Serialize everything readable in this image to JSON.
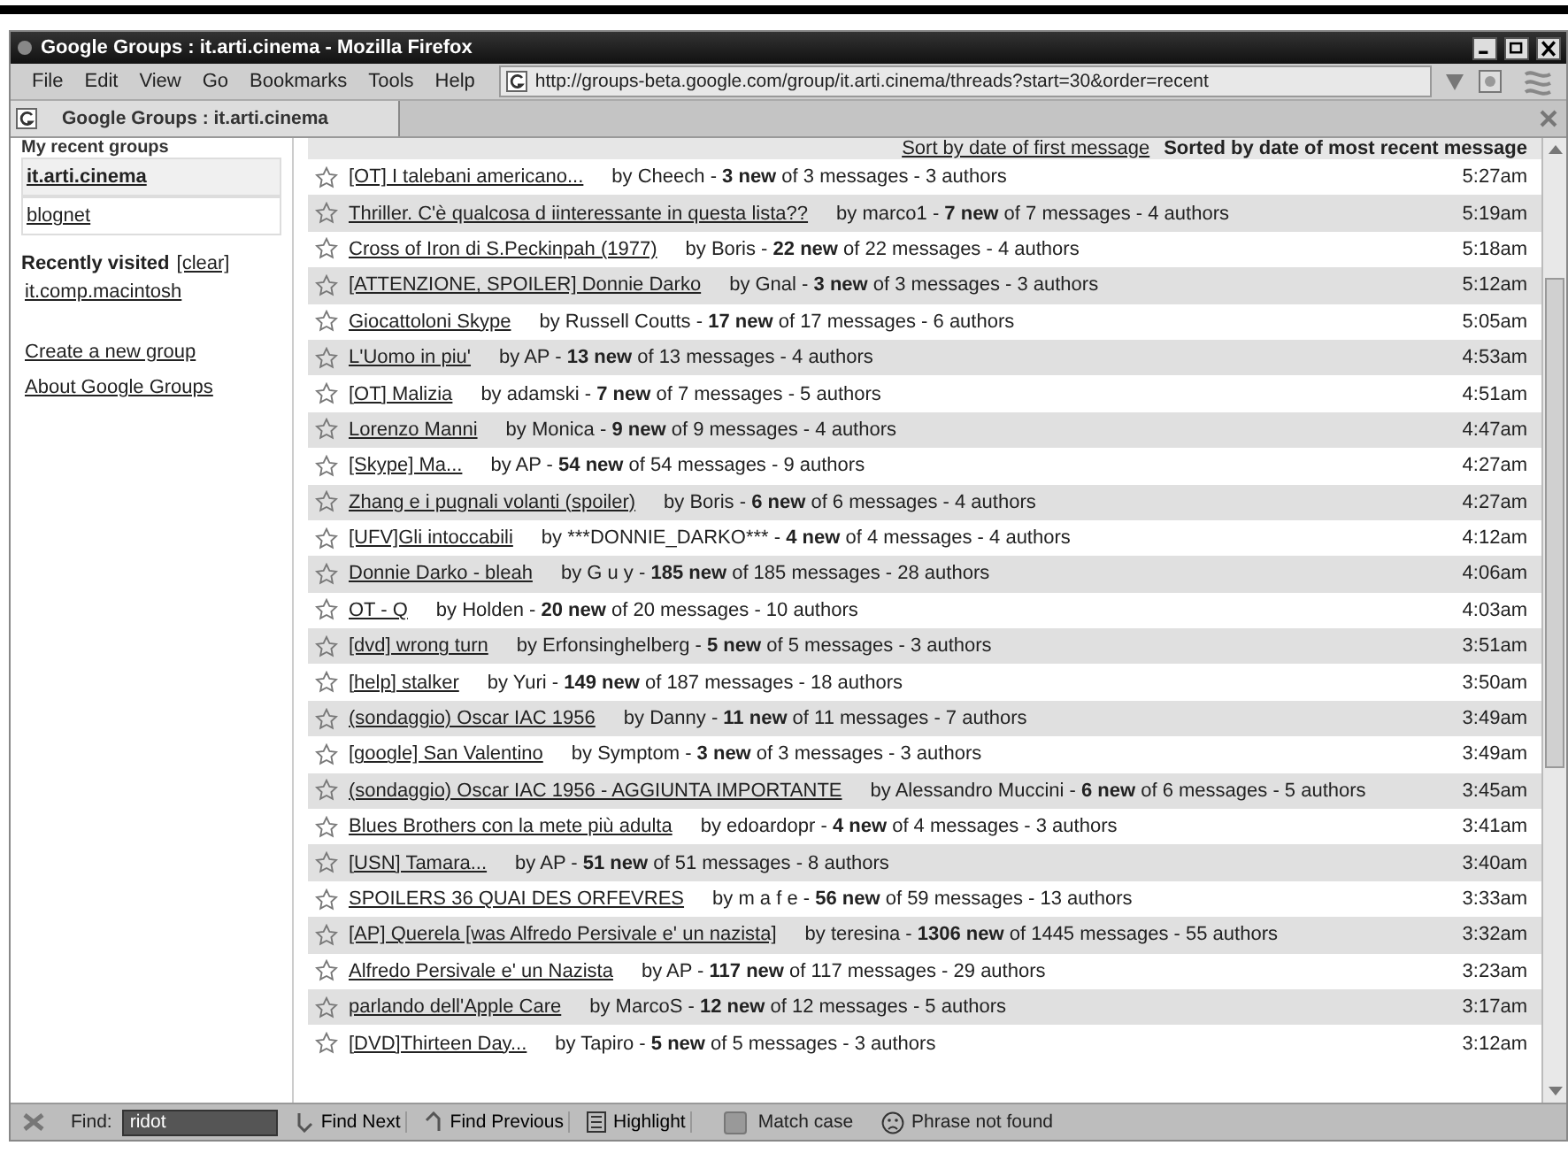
{
  "window": {
    "title": "Google Groups : it.arti.cinema - Mozilla Firefox"
  },
  "menu": [
    "File",
    "Edit",
    "View",
    "Go",
    "Bookmarks",
    "Tools",
    "Help"
  ],
  "address": "http://groups-beta.google.com/group/it.arti.cinema/threads?start=30&order=recent",
  "tabs": [
    {
      "label": "Google Groups : it.arti.cinema",
      "selected": true
    }
  ],
  "sidebar": {
    "heading": "My recent groups",
    "groups": [
      {
        "label": "it.arti.cinema",
        "selected": true
      },
      {
        "label": "blognet",
        "selected": false
      }
    ],
    "recent_heading": "Recently visited",
    "clear_link": "[clear]",
    "recent": [
      "it.comp.macintosh"
    ],
    "links": [
      "Create a new group",
      "About Google Groups"
    ]
  },
  "sort": {
    "link": "Sort by date of first message",
    "current": "Sorted by date of most recent message"
  },
  "threads": [
    {
      "title": "[OT] I talebani americano...",
      "info": [
        "by Cheech  -  ",
        "3 new",
        " of 3 messages - 3 authors"
      ],
      "time": "5:27am",
      "starred": false
    },
    {
      "title": "Thriller. C'è qualcosa d iinteressante in questa lista??",
      "info": [
        "by marco1  -  ",
        "7 new",
        " of 7 messages - 4 authors"
      ],
      "time": "5:19am",
      "starred": false
    },
    {
      "title": "Cross of Iron di S.Peckinpah (1977)",
      "info": [
        "by Boris  -  ",
        "22 new",
        " of 22 messages - 4 authors"
      ],
      "time": "5:18am",
      "starred": false
    },
    {
      "title": "[ATTENZIONE, SPOILER] Donnie Darko",
      "info": [
        "by Gnal  -  ",
        "3 new",
        " of 3 messages - 3 authors"
      ],
      "time": "5:12am",
      "starred": false
    },
    {
      "title": "Giocattoloni Skype",
      "info": [
        "by Russell Coutts  -  ",
        "17 new",
        " of 17 messages - 6 authors"
      ],
      "time": "5:05am",
      "starred": false
    },
    {
      "title": "L'Uomo in piu'",
      "info": [
        "by AP  -  ",
        "13 new",
        " of 13 messages - 4 authors"
      ],
      "time": "4:53am",
      "starred": false
    },
    {
      "title": "[OT] Malizia",
      "info": [
        "by adamski  -  ",
        "7 new",
        " of 7 messages - 5 authors"
      ],
      "time": "4:51am",
      "starred": false
    },
    {
      "title": "Lorenzo Manni",
      "info": [
        "by Monica  -  ",
        "9 new",
        " of 9 messages - 4 authors"
      ],
      "time": "4:47am",
      "starred": false
    },
    {
      "title": "[Skype] Ma...",
      "info": [
        "by AP  -  ",
        "54 new",
        " of 54 messages - 9 authors"
      ],
      "time": "4:27am",
      "starred": false
    },
    {
      "title": "Zhang e i pugnali volanti (spoiler)",
      "info": [
        "by Boris  -  ",
        "6 new",
        " of 6 messages - 4 authors"
      ],
      "time": "4:27am",
      "starred": false
    },
    {
      "title": "[UFV]Gli intoccabili",
      "info": [
        "by ***DONNIE_DARKO***  -  ",
        "4 new",
        " of 4 messages - 4 authors"
      ],
      "time": "4:12am",
      "starred": false
    },
    {
      "title": "Donnie Darko - bleah",
      "info": [
        "by G u y  -  ",
        "185 new",
        " of 185 messages - 28 authors"
      ],
      "time": "4:06am",
      "starred": false
    },
    {
      "title": "OT - Q",
      "info": [
        "by Holden  -  ",
        "20 new",
        " of 20 messages - 10 authors"
      ],
      "time": "4:03am",
      "starred": false
    },
    {
      "title": "[dvd] wrong turn",
      "info": [
        "by Erfonsinghelberg  -  ",
        "5 new",
        " of 5 messages - 3 authors"
      ],
      "time": "3:51am",
      "starred": false
    },
    {
      "title": "[help] stalker",
      "info": [
        "by Yuri  -  ",
        "149 new",
        " of 187 messages - 18 authors"
      ],
      "time": "3:50am",
      "starred": false
    },
    {
      "title": "(sondaggio) Oscar IAC 1956",
      "info": [
        "by Danny  -  ",
        "11 new",
        " of 11 messages - 7 authors"
      ],
      "time": "3:49am",
      "starred": false
    },
    {
      "title": "[google] San Valentino",
      "info": [
        "by Symptom  -  ",
        "3 new",
        " of 3 messages - 3 authors"
      ],
      "time": "3:49am",
      "starred": false
    },
    {
      "title": "(sondaggio) Oscar IAC 1956 - AGGIUNTA IMPORTANTE",
      "info": [
        "by Alessandro Muccini  -  ",
        "6 new",
        " of 6 messages - 5 authors"
      ],
      "time": "3:45am",
      "starred": false
    },
    {
      "title": "Blues Brothers con la mete più adulta",
      "info": [
        "by edoardopr  -  ",
        "4 new",
        " of 4 messages - 3 authors"
      ],
      "time": "3:41am",
      "starred": false
    },
    {
      "title": "[USN] Tamara...",
      "info": [
        "by AP  -  ",
        "51 new",
        " of 51 messages - 8 authors"
      ],
      "time": "3:40am",
      "starred": false
    },
    {
      "title": "SPOILERS 36 QUAI DES ORFEVRES",
      "info": [
        "by m a f e  -  ",
        "56 new",
        " of 59 messages - 13 authors"
      ],
      "time": "3:33am",
      "starred": false
    },
    {
      "title": "[AP] Querela [was Alfredo Persivale e' un nazista]",
      "info": [
        "by teresina  -  ",
        "1306 new",
        " of 1445 messages - 55 authors"
      ],
      "time": "3:32am",
      "starred": false
    },
    {
      "title": "Alfredo Persivale e' un Nazista",
      "info": [
        "by AP  -  ",
        "117 new",
        " of 117 messages - 29 authors"
      ],
      "time": "3:23am",
      "starred": false
    },
    {
      "title": "parlando dell'Apple Care",
      "info": [
        "by MarcoS  -  ",
        "12 new",
        " of 12 messages - 5 authors"
      ],
      "time": "3:17am",
      "starred": false
    },
    {
      "title": "[DVD]Thirteen Day...",
      "info": [
        "by Tapiro  -  ",
        "5 new",
        " of 5 messages - 3 authors"
      ],
      "time": "3:12am",
      "starred": false
    }
  ],
  "find_bar": {
    "label": "Find:",
    "value": "ridot",
    "buttons": [
      "Find Next",
      "Find Previous",
      "Highlight"
    ],
    "match_case": {
      "label": "Match case",
      "checked": false
    },
    "status": "Phrase not found"
  }
}
